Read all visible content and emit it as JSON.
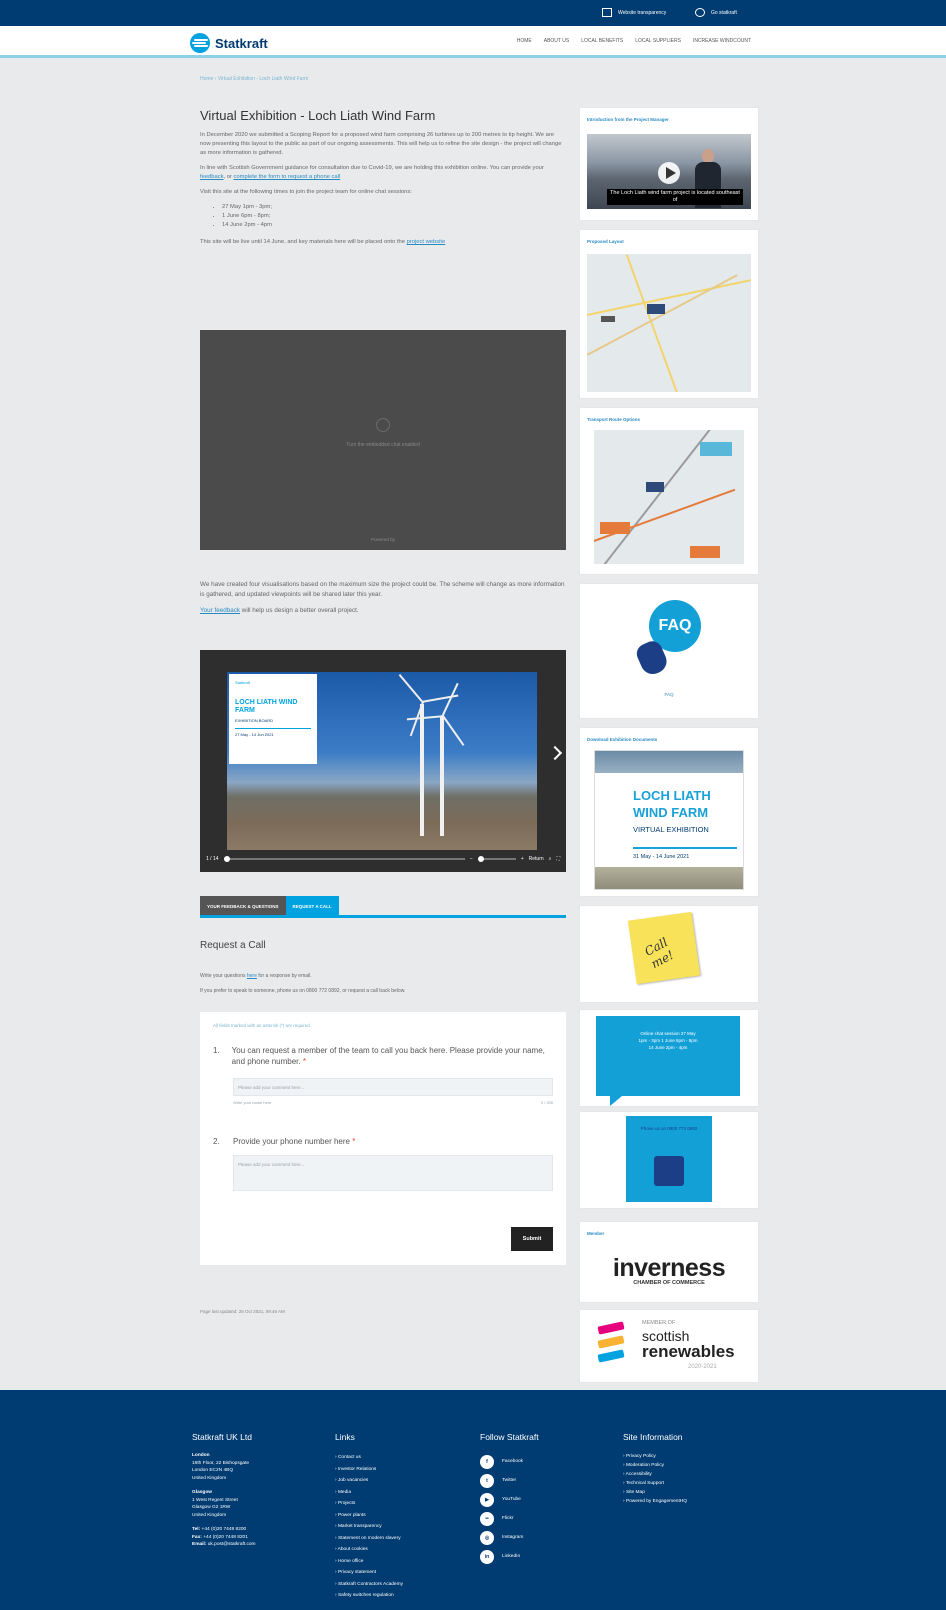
{
  "topbar": {
    "link1": "Website transparency",
    "link2": "Go statkraft"
  },
  "header": {
    "logo_text": "Statkraft",
    "nav": [
      "HOME",
      "ABOUT US",
      "LOCAL BENEFITS",
      "LOCAL SUPPLIERS",
      "INCREASE WINDCOUNT"
    ]
  },
  "breadcrumb": "Home › Virtual Exhibition - Loch Liath Wind Farm",
  "main": {
    "title": "Virtual Exhibition - Loch Liath Wind Farm",
    "p1": "In December 2020 we submitted a Scoping Report for a proposed wind farm comprising 26 turbines up to 200 metres to tip height. We are now presenting this layout to the public as part of our ongoing assessments. This will help us to refine the site design - the project will change as more information is gathered.",
    "p2_pre": "In line with Scottish Government guidance for consultation due to Covid-19, we are holding this exhibition online. You can provide your",
    "p2_link1": "feedback",
    "p2_mid": ", or",
    "p2_link2": "complete the form to request a phone call",
    "p3": "Visit this site at the following times to join the project team for online chat sessions:",
    "dates": [
      "27 May 1pm - 3pm;",
      "1 June 6pm - 8pm;",
      "14 June 2pm - 4pm"
    ],
    "p4_pre": "This site will be live until 14 June, and key materials here will be placed onto the",
    "p4_link": "project website",
    "embed_msg": "Turn the embedded chat enabled",
    "embed_foot": "Powered by",
    "p5": "We have created four visualisations based on the maximum size the project could be. The scheme will change as more information is gathered, and updated viewpoints will be shared later this year.",
    "p6_link": "Your feedback",
    "p6_rest": "will help us design a better overall project.",
    "slide_card": {
      "brand": "Statkraft",
      "title": "LOCH LIATH WIND FARM",
      "sub": "EXHIBITION BOARD",
      "date": "27 May - 14 Jun 2021"
    },
    "slider_counter": "1 / 14",
    "slider_return": "Return",
    "tabs": [
      "YOUR FEEDBACK & QUESTIONS",
      "REQUEST A CALL"
    ],
    "request_title": "Request a Call",
    "rq_p1_pre": "Write your questions",
    "rq_p1_link": "here",
    "rq_p1_post": "for a response by email.",
    "rq_p2": "If you prefer to speak to someone, phone us on 0800 772 0892, or request a call back below.",
    "form": {
      "required_note": "All fields marked with an asterisk (*) are required.",
      "q1_num": "1.",
      "q1": "You can request a member of the team to call you back here. Please provide your name, and phone number.",
      "q1_placeholder": "Please add your comment here...",
      "q1_hint": "Write your name here",
      "q1_count": "0 / 255",
      "q2_num": "2.",
      "q2": "Provide your phone number here",
      "q2_placeholder": "Please add your comment here...",
      "star": "*",
      "submit": "Submit"
    },
    "updated": "Page last updated: 28 Oct 2021, 09:46 AM"
  },
  "sidebar": {
    "video_title": "Introduction from the Project Manager",
    "video_caption": "The Loch Liath wind farm project is located southeast of",
    "map_title": "Proposed Layout",
    "route_title": "Transport Route Options",
    "faq_bubble": "FAQ",
    "faq_label": "FAQ",
    "docs_title": "Download Exhibition Documents",
    "cover_title": "LOCH LIATH WIND FARM",
    "cover_sub": "VIRTUAL EXHIBITION",
    "cover_date": "31 May - 14 June 2021",
    "note_text": "Call me!",
    "chat_text": "Online chat session 27 May 1pm - 3pm 1 June 6pm - 8pm 14 June 2pm - 4pm",
    "phone_text": "Phone us on 0800 772 0892",
    "member_title": "Member",
    "inverness_word": "inverness",
    "inverness_sub": "CHAMBER OF COMMERCE",
    "sr_member": "MEMBER OF",
    "sr_word1": "scottish",
    "sr_word2": "renewables",
    "sr_year": "2020-2021"
  },
  "footer": {
    "c1_title": "Statkraft UK Ltd",
    "london": "London",
    "london_addr": [
      "19th Floor, 22 Bishopsgate",
      "London EC2N 4BQ",
      "United Kingdom"
    ],
    "glasgow": "Glasgow",
    "glasgow_addr": [
      "1 West Regent Street",
      "Glasgow G2 1RW",
      "United Kingdom"
    ],
    "tel_label": "Tel:",
    "tel": "+44 (0)20 7448 8200",
    "fax_label": "Fax:",
    "fax": "+44 (0)20 7448 8201",
    "email_label": "Email:",
    "email": "uk.post@statkraft.com",
    "c2_title": "Links",
    "links": [
      "Contact us",
      "Investor Relations",
      "Job vacancies",
      "Media",
      "Projects",
      "Power plants",
      "Market transparency",
      "Statement on modern slavery",
      "About cookies",
      "Home office",
      "Privacy statement",
      "Statkraft Contractors Academy",
      "Safety switches regulation"
    ],
    "c3_title": "Follow Statkraft",
    "social": [
      {
        "icon": "f",
        "label": "Facebook"
      },
      {
        "icon": "t",
        "label": "Twitter"
      },
      {
        "icon": "▶",
        "label": "YouTube"
      },
      {
        "icon": "••",
        "label": "Flickr"
      },
      {
        "icon": "◎",
        "label": "Instagram"
      },
      {
        "icon": "in",
        "label": "LinkedIn"
      }
    ],
    "c4_title": "Site Information",
    "site_info": [
      "Privacy Policy",
      "Moderation Policy",
      "Accessibility",
      "Technical Support",
      "Site Map",
      "Powered by EngagementHQ"
    ]
  }
}
